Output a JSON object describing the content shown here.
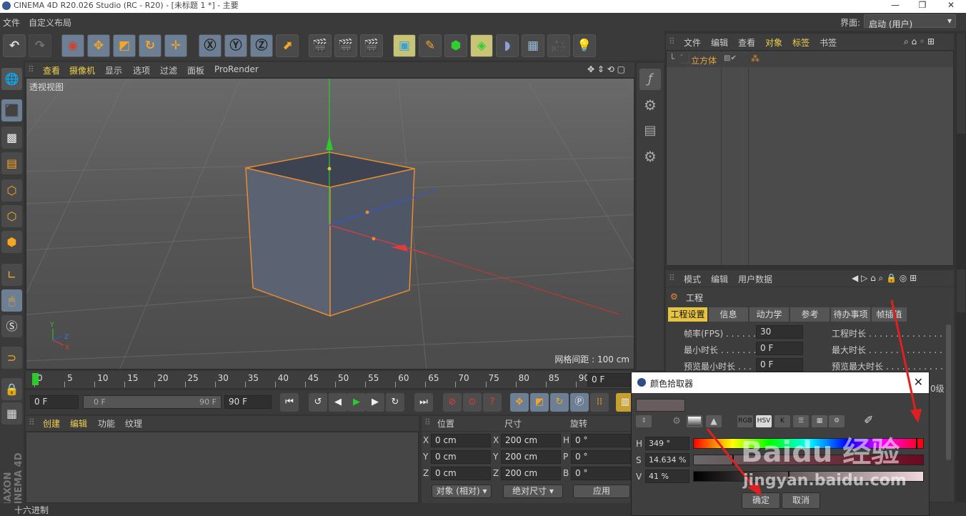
{
  "titlebar": {
    "title": "CINEMA 4D R20.026 Studio (RC - R20) - [未标题 1 *] - 主要"
  },
  "menubar": {
    "items": [
      "文件",
      "自定义布局"
    ],
    "layout_label": "界面:",
    "layout_value": "启动 (用户)"
  },
  "viewport": {
    "menu": [
      "查看",
      "摄像机",
      "显示",
      "选项",
      "过滤",
      "面板",
      "ProRender"
    ],
    "label": "透视视图",
    "grid": "网格间距 : 100 cm"
  },
  "timeline": {
    "ticks": [
      "0",
      "5",
      "10",
      "15",
      "20",
      "25",
      "30",
      "35",
      "40",
      "45",
      "50",
      "55",
      "60",
      "65",
      "70",
      "75",
      "80",
      "85",
      "90"
    ],
    "end_field": "0 F"
  },
  "transport": {
    "start": "0 F",
    "range_start": "0 F",
    "range_end": "90 F",
    "end": "90 F"
  },
  "objmgr": {
    "menu": [
      "文件",
      "编辑",
      "查看",
      "对象",
      "标签",
      "书签"
    ],
    "object": "立方体"
  },
  "attr": {
    "menu": [
      "模式",
      "编辑",
      "用户数据"
    ],
    "section": "工程",
    "tabs": [
      "工程设置",
      "信息",
      "动力学",
      "参考",
      "待办事项",
      "帧插值"
    ],
    "rows": [
      {
        "label": "帧率(FPS) . . . . . .",
        "value": "30",
        "label2": "工程时长 . . . . . . . . . . . . . ."
      },
      {
        "label": "最小时长 . . . . . . .",
        "value": "0 F",
        "label2": "最大时长 . . . . . . . . . . . . . ."
      },
      {
        "label": "预览最小时长 . . .",
        "value": "0 F",
        "label2": "预览最大时长 . . . . . . . . . . . ."
      }
    ],
    "side_text": "0级"
  },
  "material": {
    "menu": [
      "创建",
      "编辑",
      "功能",
      "纹理"
    ]
  },
  "coords": {
    "headers": [
      "位置",
      "尺寸",
      "旋转"
    ],
    "rows": [
      {
        "a": "X",
        "av": "0 cm",
        "b": "X",
        "bv": "200 cm",
        "c": "H",
        "cv": "0 °"
      },
      {
        "a": "Y",
        "av": "0 cm",
        "b": "Y",
        "bv": "200 cm",
        "c": "P",
        "cv": "0 °"
      },
      {
        "a": "Z",
        "av": "0 cm",
        "b": "Z",
        "bv": "200 cm",
        "c": "B",
        "cv": "0 °"
      }
    ],
    "mode1": "对象 (相对)",
    "mode2": "绝对尺寸",
    "apply": "应用"
  },
  "statusbar": {
    "text": "十六进制"
  },
  "picker": {
    "title": "颜色拾取器",
    "buttons": [
      "RGB",
      "HSV",
      "K"
    ],
    "h_label": "H",
    "h": "349 °",
    "s_label": "S",
    "s": "14.634 %",
    "v_label": "V",
    "v": "41 %",
    "ok": "确定",
    "cancel": "取消",
    "swatch_color": "#695c5e",
    "h_fraction": 0.969,
    "s_fraction": 0.146,
    "v_fraction": 0.41
  },
  "watermark": {
    "text": "Baidu 经验",
    "url": "jingyan.baidu.com"
  },
  "colors": {
    "selection": "#e6c341",
    "object": "#e8a441",
    "cube_outline": "#e98c2e"
  }
}
